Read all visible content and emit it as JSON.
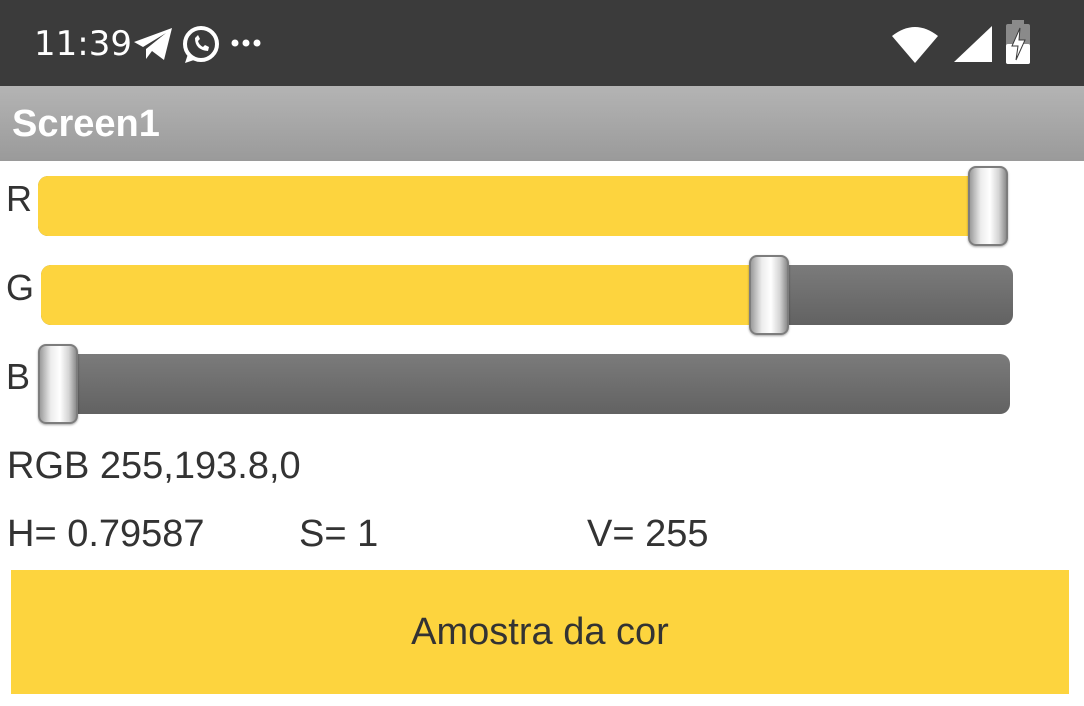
{
  "status_bar": {
    "time": "11:39",
    "icons": [
      "telegram-icon",
      "whatsapp-icon",
      "more-notifications-icon",
      "wifi-icon",
      "cellular-signal-icon",
      "battery-charging-icon"
    ]
  },
  "title_bar": {
    "title": "Screen1"
  },
  "sliders": [
    {
      "label": "R",
      "value": 255,
      "min": 0,
      "max": 255
    },
    {
      "label": "G",
      "value": 193.8,
      "min": 0,
      "max": 255
    },
    {
      "label": "B",
      "value": 0,
      "min": 0,
      "max": 255
    }
  ],
  "info": {
    "rgb": "RGB 255,193.8,0",
    "h": "H= 0.79587",
    "s": "S= 1",
    "v": "V= 255"
  },
  "sample_button": {
    "label": "Amostra da cor"
  },
  "colors": {
    "status_bar_bg": "#3b3b3b",
    "title_bar_bg": "#a8a8a8",
    "accent_yellow": "#fdd43e",
    "track_gray": "#6e6e6e"
  }
}
